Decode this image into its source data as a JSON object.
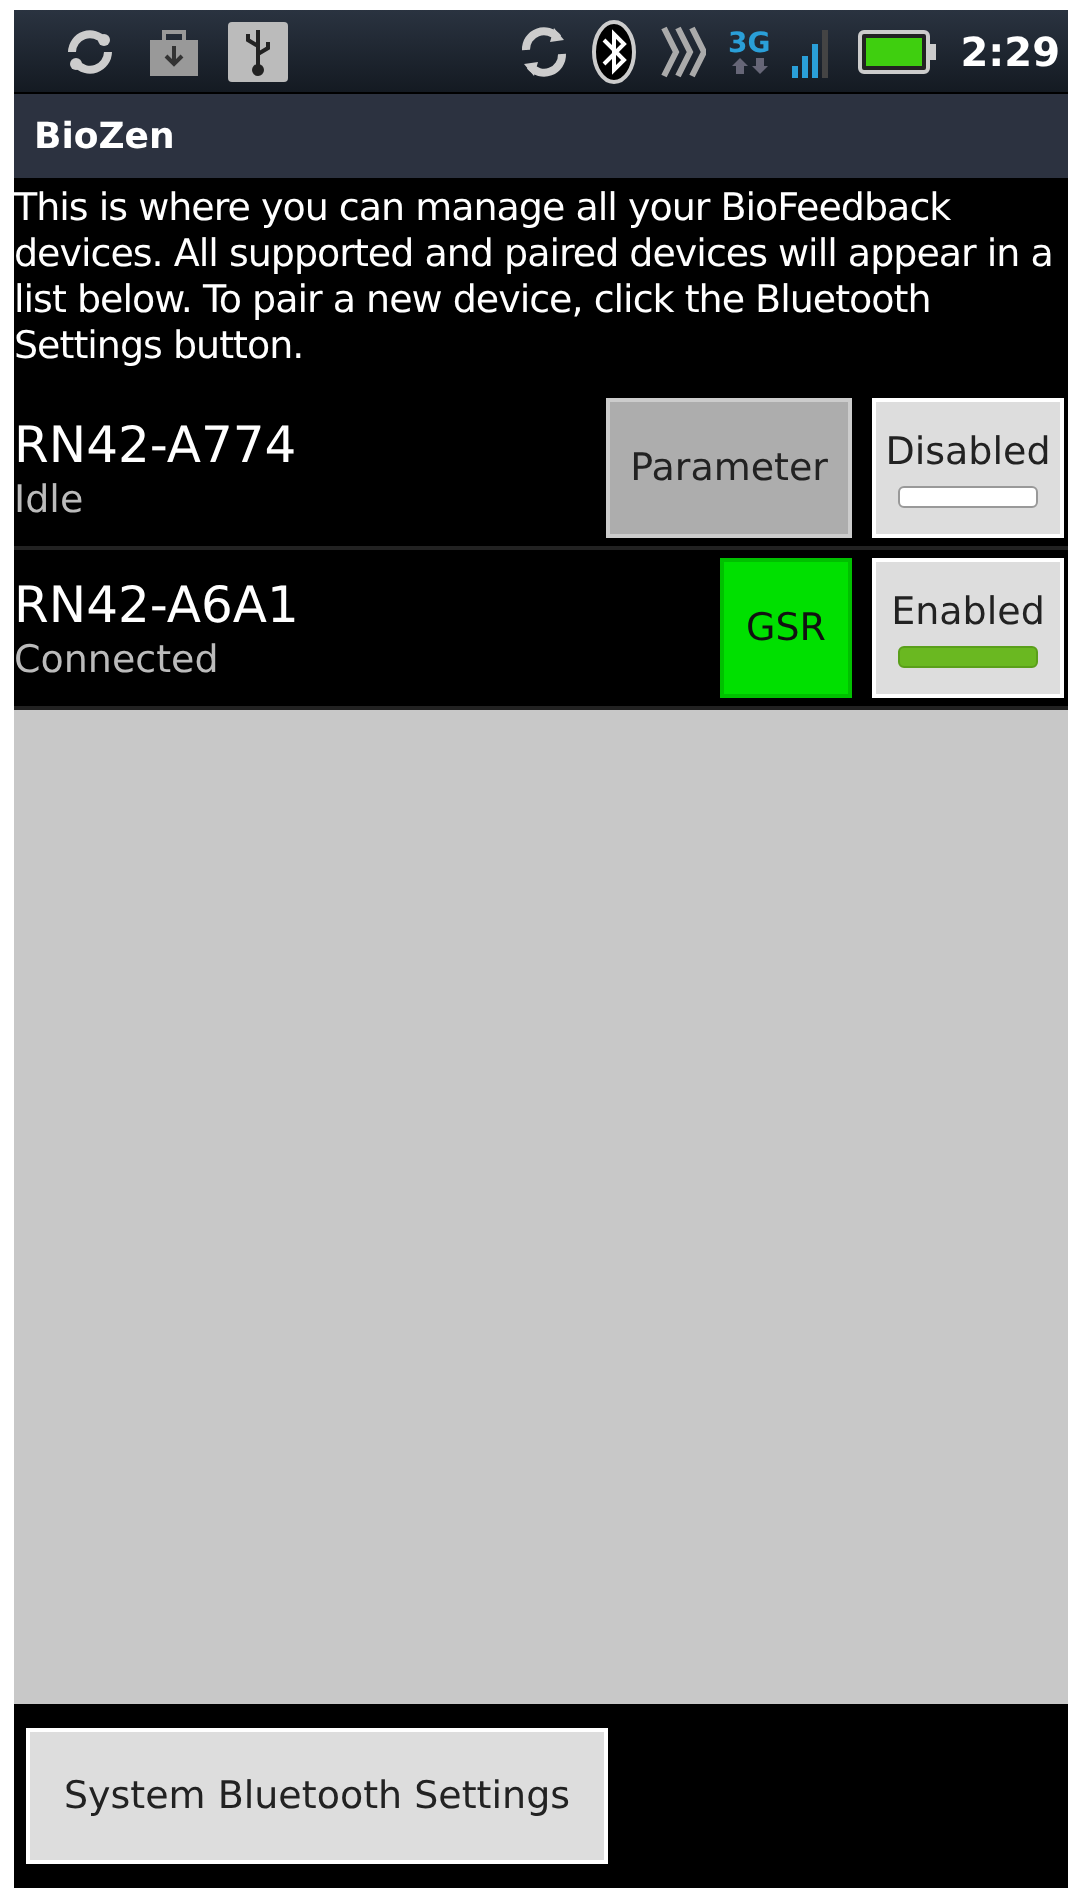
{
  "status_bar": {
    "network_type": "3G",
    "time": "2:29"
  },
  "title_bar": {
    "title": "BioZen"
  },
  "description": "This is where you can manage all your BioFeedback devices. All supported and paired devices will appear in a list below. To pair a new device, click the Bluetooth Settings button.",
  "devices": [
    {
      "name": "RN42-A774",
      "status": "Idle",
      "action": {
        "label": "Parameter",
        "kind": "parameter"
      },
      "toggle": {
        "label": "Disabled",
        "enabled": false
      }
    },
    {
      "name": "RN42-A6A1",
      "status": "Connected",
      "action": {
        "label": "GSR",
        "kind": "sensor"
      },
      "toggle": {
        "label": "Enabled",
        "enabled": true
      }
    }
  ],
  "bottom_button": "System Bluetooth Settings"
}
